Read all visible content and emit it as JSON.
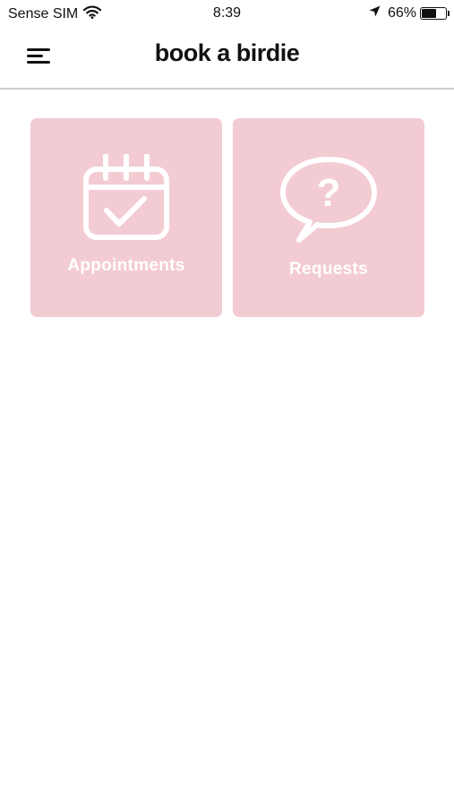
{
  "status_bar": {
    "carrier": "Sense SIM",
    "time": "8:39",
    "battery_percent": "66%",
    "battery_level": 0.66,
    "icons": [
      "wifi-icon",
      "location-arrow-icon",
      "battery-icon"
    ]
  },
  "header": {
    "title": "book a birdie",
    "menu_icon": "hamburger-menu-icon"
  },
  "tiles": [
    {
      "label": "Appointments",
      "icon": "calendar-check-icon"
    },
    {
      "label": "Requests",
      "icon": "question-speech-bubble-icon"
    }
  ],
  "colors": {
    "tile_background": "#f3cbd3",
    "tile_foreground": "#ffffff",
    "divider": "#cfcfcf",
    "text": "#111111"
  }
}
